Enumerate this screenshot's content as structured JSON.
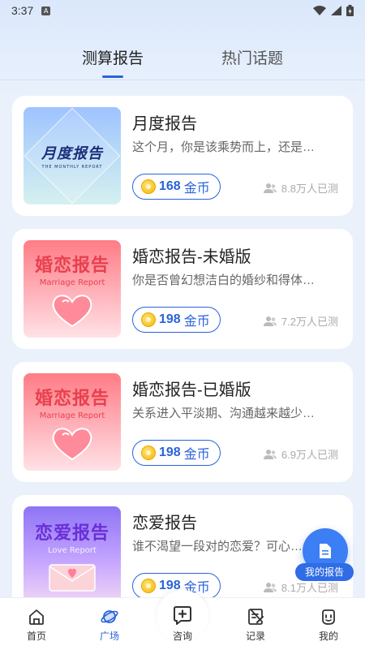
{
  "status_bar": {
    "time": "3:37",
    "notification_badge": "A"
  },
  "tabs": [
    {
      "label": "测算报告",
      "active": true
    },
    {
      "label": "热门话题",
      "active": false
    }
  ],
  "cards": [
    {
      "thumb_title": "月度报告",
      "thumb_sub": "THE MONTHLY REPORT",
      "title": "月度报告",
      "desc": "这个月，你是该乘势而上，还是…",
      "price": "168",
      "currency": "金币",
      "testers": "8.8万人已测"
    },
    {
      "thumb_title": "婚恋报告",
      "thumb_sub": "Marriage Report",
      "title": "婚恋报告-未婚版",
      "desc": "你是否曾幻想洁白的婚纱和得体…",
      "price": "198",
      "currency": "金币",
      "testers": "7.2万人已测"
    },
    {
      "thumb_title": "婚恋报告",
      "thumb_sub": "Marriage Report",
      "title": "婚恋报告-已婚版",
      "desc": "关系进入平淡期、沟通越来越少…",
      "price": "198",
      "currency": "金币",
      "testers": "6.9万人已测"
    },
    {
      "thumb_title": "恋爱报告",
      "thumb_sub": "Love     Report",
      "title": "恋爱报告",
      "desc": "谁不渴望一段对的恋爱？可心…",
      "price": "198",
      "currency": "金币",
      "testers": "8.1万人已测"
    }
  ],
  "fab": {
    "label": "我的报告",
    "icon": "document-icon"
  },
  "bottom_nav": [
    {
      "label": "首页",
      "icon": "home-icon",
      "active": false
    },
    {
      "label": "广场",
      "icon": "planet-icon",
      "active": true
    },
    {
      "label": "咨询",
      "icon": "chat-plus-icon",
      "active": false
    },
    {
      "label": "记录",
      "icon": "record-icon",
      "active": false
    },
    {
      "label": "我的",
      "icon": "face-icon",
      "active": false
    }
  ],
  "colors": {
    "accent": "#2b63d9",
    "fab": "#3c7ef3",
    "background": "#eaf1fb"
  }
}
